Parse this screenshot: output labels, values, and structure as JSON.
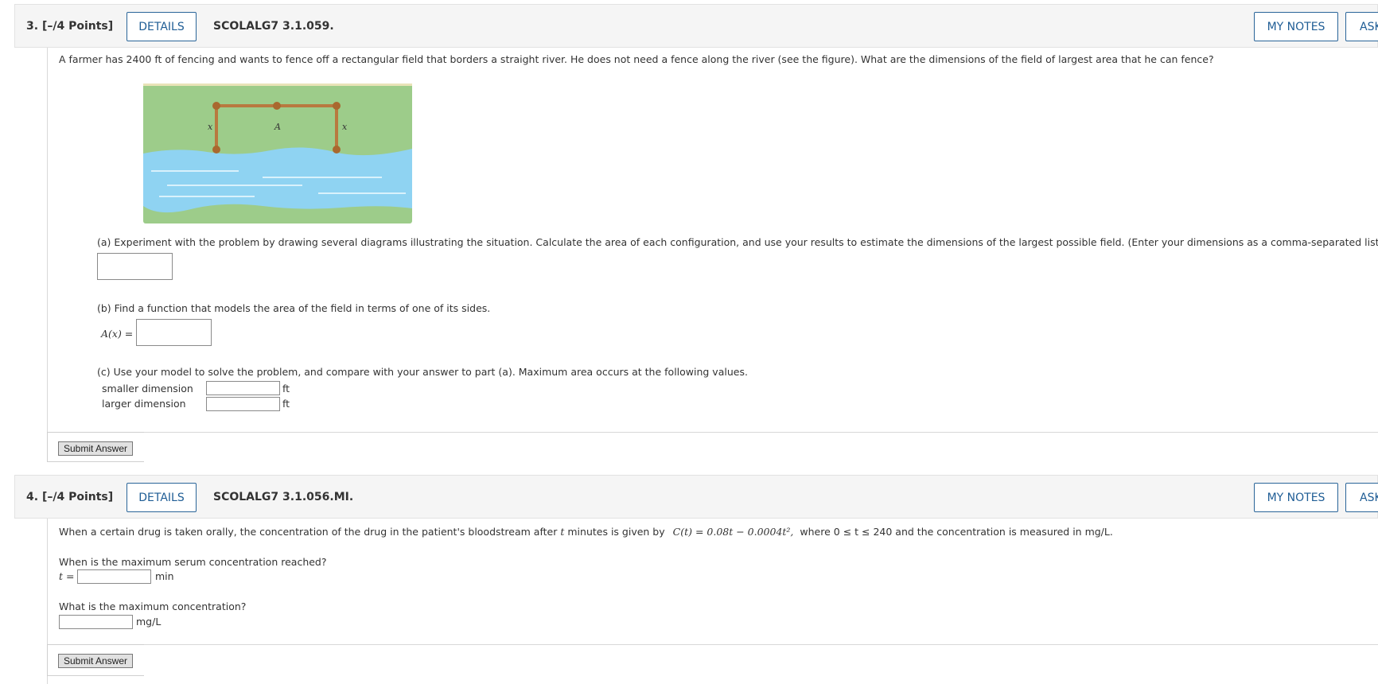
{
  "q3": {
    "number": "3.",
    "points": "[–/4 Points]",
    "details_label": "DETAILS",
    "code": "SCOLALG7 3.1.059.",
    "my_notes_label": "MY NOTES",
    "ask_label": "ASK",
    "problem_text": "A farmer has 2400 ft of fencing and wants to fence off a rectangular field that borders a straight river. He does not need a fence along the river (see the figure). What are the dimensions of the field of largest area that he can fence?",
    "figure": {
      "label_x_left": "x",
      "label_a": "A",
      "label_x_right": "x",
      "colors": {
        "field": "#9dcc8a",
        "river": "#8fd3f2",
        "fence": "#b8793f"
      }
    },
    "part_a": "(a) Experiment with the problem by drawing several diagrams illustrating the situation. Calculate the area of each configuration, and use your results to estimate the dimensions of the largest possible field. (Enter your dimensions as a comma-separated list.)",
    "part_b": "(b) Find a function that models the area of the field in terms of one of its sides.",
    "part_b_label": "A(x) =",
    "part_c": "(c) Use your model to solve the problem, and compare with your answer to part (a). Maximum area occurs at the following values.",
    "smaller_label": "smaller dimension",
    "larger_label": "larger dimension",
    "unit_ft": "ft",
    "submit_label": "Submit Answer"
  },
  "q4": {
    "number": "4.",
    "points": "[–/4 Points]",
    "details_label": "DETAILS",
    "code": "SCOLALG7 3.1.056.MI.",
    "my_notes_label": "MY NOTES",
    "ask_label": "ASK",
    "problem_prefix": "When a certain drug is taken orally, the concentration of the drug in the patient's bloodstream after",
    "var_t": "t",
    "problem_mid": "minutes is given by",
    "formula": "C(t) = 0.08t − 0.0004t²,",
    "problem_suffix": "where 0 ≤ t ≤ 240 and the concentration is measured in mg/L.",
    "q1_text": "When is the maximum serum concentration reached?",
    "t_label": "t =",
    "unit_min": "min",
    "q2_text": "What is the maximum concentration?",
    "unit_mgL": "mg/L",
    "submit_label": "Submit Answer"
  }
}
